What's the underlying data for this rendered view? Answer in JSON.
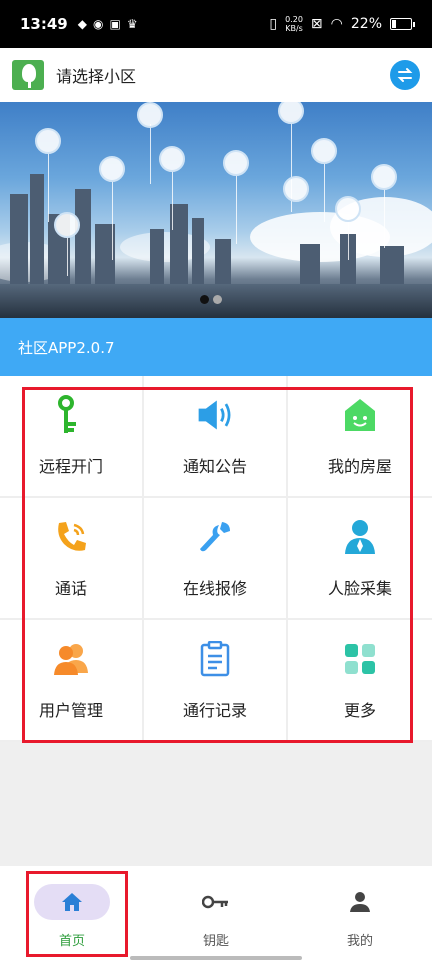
{
  "status_bar": {
    "time": "13:49",
    "speed_top": "0.20",
    "speed_bottom": "KB/s",
    "battery": "22%",
    "battery_level": 0.22
  },
  "header": {
    "title": "请选择小区"
  },
  "banner": {
    "page_count": 2,
    "active_page": 0
  },
  "version": {
    "label": "社区APP2.0.7"
  },
  "grid": {
    "items": [
      {
        "label": "远程开门",
        "icon": "key-icon",
        "color": "#2db52d"
      },
      {
        "label": "通知公告",
        "icon": "speaker-icon",
        "color": "#2c9ee6"
      },
      {
        "label": "我的房屋",
        "icon": "house-icon",
        "color": "#4cd964"
      },
      {
        "label": "通话",
        "icon": "phone-icon",
        "color": "#f4a21b"
      },
      {
        "label": "在线报修",
        "icon": "wrench-icon",
        "color": "#3aa0f0"
      },
      {
        "label": "人脸采集",
        "icon": "person-icon",
        "color": "#24a8d8"
      },
      {
        "label": "用户管理",
        "icon": "users-icon",
        "color": "#f68a2a"
      },
      {
        "label": "通行记录",
        "icon": "clipboard-icon",
        "color": "#3d8fe6"
      },
      {
        "label": "更多",
        "icon": "grid-icon",
        "color": "#2cc3a6"
      }
    ]
  },
  "bottom_nav": {
    "items": [
      {
        "label": "首页",
        "icon": "home-icon"
      },
      {
        "label": "钥匙",
        "icon": "key-icon"
      },
      {
        "label": "我的",
        "icon": "person-icon"
      }
    ],
    "active_index": 0
  },
  "colors": {
    "accent": "#3fa9f5",
    "active_nav": "#2e9d3c",
    "highlight": "#e8192c"
  }
}
